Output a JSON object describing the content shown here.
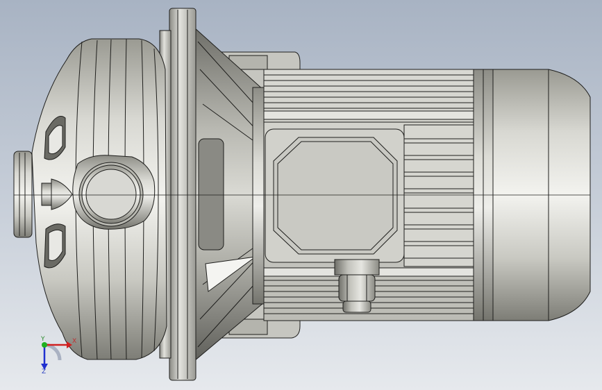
{
  "viewport": {
    "background_top": "#a8b3c3",
    "background_bottom": "#e6e9ed",
    "model": "centrifugal-pump-with-electric-motor"
  },
  "triad": {
    "x_label": "X",
    "y_label": "Y",
    "z_label": "Z",
    "x_color": "#d02020",
    "y_color": "#20b020",
    "z_color": "#2030d0"
  }
}
